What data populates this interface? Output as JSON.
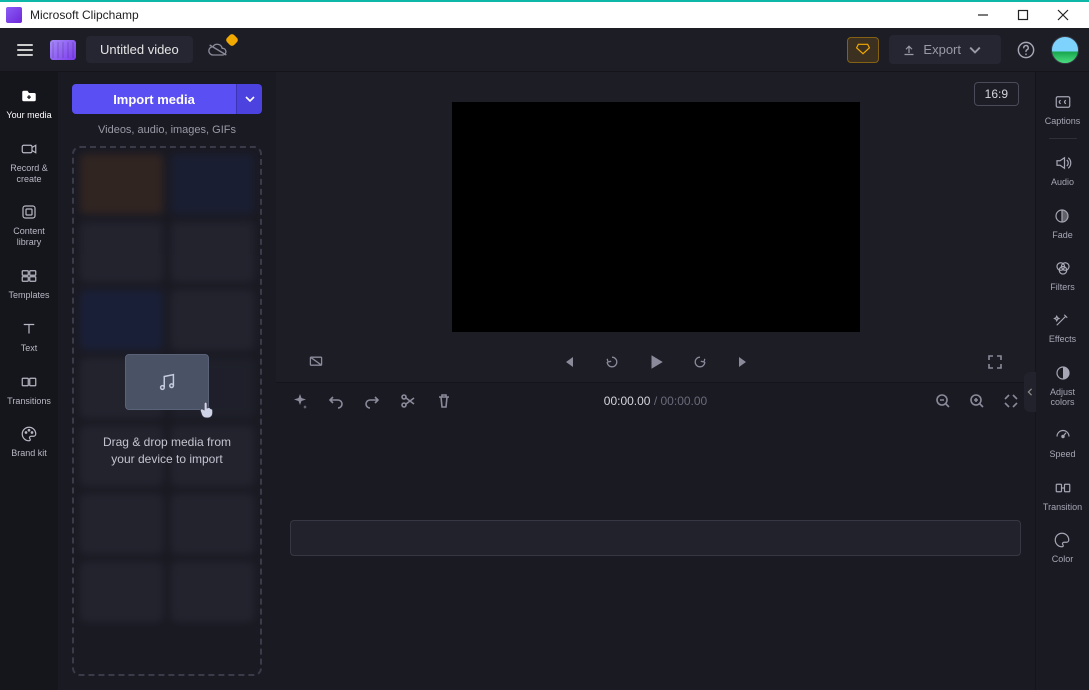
{
  "window": {
    "title": "Microsoft Clipchamp"
  },
  "toolbar": {
    "project_name": "Untitled video",
    "export_label": "Export"
  },
  "left_rail": [
    {
      "id": "your-media",
      "label": "Your media",
      "icon": "folder"
    },
    {
      "id": "record-create",
      "label": "Record & create",
      "icon": "camera"
    },
    {
      "id": "content-library",
      "label": "Content library",
      "icon": "library"
    },
    {
      "id": "templates",
      "label": "Templates",
      "icon": "templates"
    },
    {
      "id": "text",
      "label": "Text",
      "icon": "text"
    },
    {
      "id": "transitions",
      "label": "Transitions",
      "icon": "transitions"
    },
    {
      "id": "brand-kit",
      "label": "Brand kit",
      "icon": "palette"
    }
  ],
  "media_panel": {
    "import_label": "Import media",
    "hint": "Videos, audio, images, GIFs",
    "drop_text_line1": "Drag & drop media from",
    "drop_text_line2": "your device to import"
  },
  "preview": {
    "aspect_label": "16:9"
  },
  "timeline": {
    "time_current": "00:00.00",
    "time_separator": " / ",
    "time_total": "00:00.00"
  },
  "right_rail": [
    {
      "id": "captions",
      "label": "Captions",
      "icon": "cc"
    },
    {
      "id": "audio",
      "label": "Audio",
      "icon": "speaker"
    },
    {
      "id": "fade",
      "label": "Fade",
      "icon": "fade"
    },
    {
      "id": "filters",
      "label": "Filters",
      "icon": "filters"
    },
    {
      "id": "effects",
      "label": "Effects",
      "icon": "wand"
    },
    {
      "id": "adjust-colors",
      "label": "Adjust colors",
      "icon": "contrast"
    },
    {
      "id": "speed",
      "label": "Speed",
      "icon": "speed"
    },
    {
      "id": "transition",
      "label": "Transition",
      "icon": "transition"
    },
    {
      "id": "color",
      "label": "Color",
      "icon": "palette2"
    }
  ],
  "icons": {}
}
